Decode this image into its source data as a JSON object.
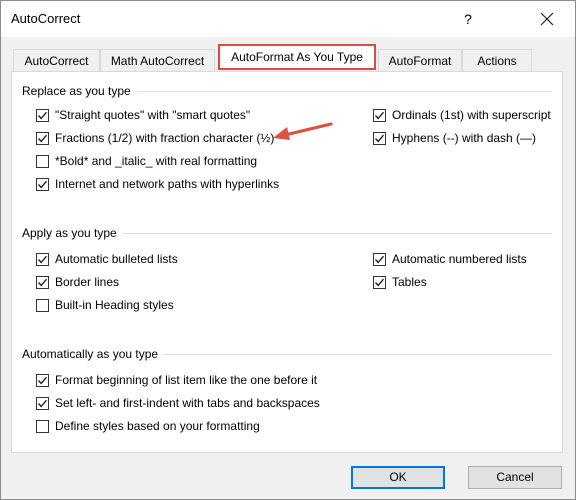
{
  "window": {
    "title": "AutoCorrect",
    "help_label": "?"
  },
  "tabs": [
    {
      "label": "AutoCorrect"
    },
    {
      "label": "Math AutoCorrect"
    },
    {
      "label": "AutoFormat As You Type",
      "active": true
    },
    {
      "label": "AutoFormat"
    },
    {
      "label": "Actions"
    }
  ],
  "sections": {
    "replace": {
      "title": "Replace as you type",
      "options": [
        {
          "label": "\"Straight quotes\" with \"smart quotes\"",
          "checked": true
        },
        {
          "label": "Fractions (1/2) with fraction character (½)",
          "checked": true
        },
        {
          "label": "*Bold* and _italic_ with real formatting",
          "checked": false
        },
        {
          "label": "Internet and network paths with hyperlinks",
          "checked": true
        },
        {
          "label": "Ordinals (1st) with superscript",
          "checked": true
        },
        {
          "label": "Hyphens (--) with dash (—)",
          "checked": true
        }
      ]
    },
    "apply": {
      "title": "Apply as you type",
      "options": [
        {
          "label": "Automatic bulleted lists",
          "checked": true
        },
        {
          "label": "Border lines",
          "checked": true
        },
        {
          "label": "Built-in Heading styles",
          "checked": false
        },
        {
          "label": "Automatic numbered lists",
          "checked": true
        },
        {
          "label": "Tables",
          "checked": true
        }
      ]
    },
    "auto": {
      "title": "Automatically as you type",
      "options": [
        {
          "label": "Format beginning of list item like the one before it",
          "checked": true
        },
        {
          "label": "Set left- and first-indent with tabs and backspaces",
          "checked": true
        },
        {
          "label": "Define styles based on your formatting",
          "checked": false
        }
      ]
    }
  },
  "buttons": {
    "ok_label": "OK",
    "cancel_label": "Cancel"
  },
  "colors": {
    "active_tab_highlight": "#e04a3a",
    "annotation_arrow": "#e05040",
    "default_button_border": "#0078d7"
  }
}
